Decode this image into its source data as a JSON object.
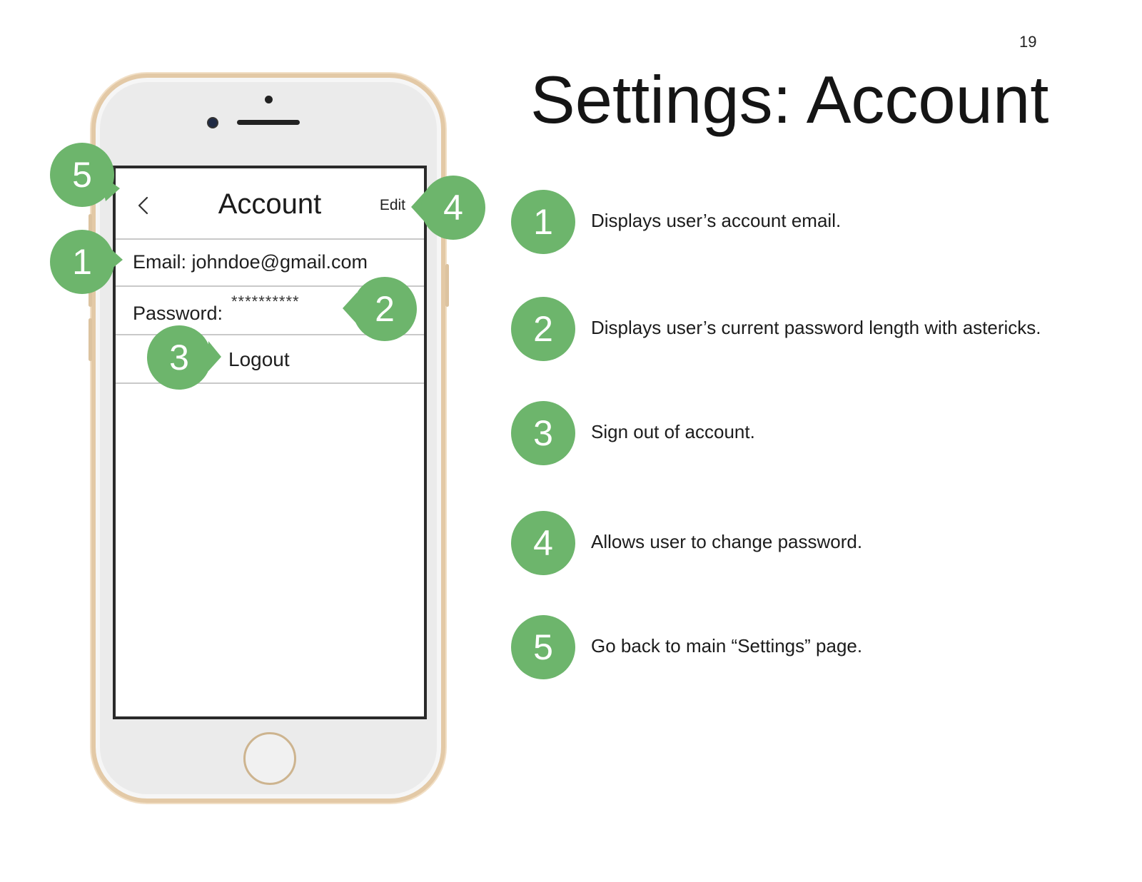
{
  "page_number": "19",
  "page_title": "Settings: Account",
  "phone_screen": {
    "nav": {
      "title": "Account",
      "edit_label": "Edit",
      "back_icon": "chevron-left-icon"
    },
    "email_row": "Email: johndoe@gmail.com",
    "password_row": {
      "label": "Password:",
      "mask": "**********"
    },
    "logout_label": "Logout"
  },
  "callouts": [
    "5",
    "1",
    "4",
    "2",
    "3"
  ],
  "legend": [
    {
      "number": "1",
      "text": "Displays user’s account email."
    },
    {
      "number": "2",
      "text": "Displays user’s current password length with astericks."
    },
    {
      "number": "3",
      "text": "Sign out of account."
    },
    {
      "number": "4",
      "text": "Allows user to change password."
    },
    {
      "number": "5",
      "text": "Go back to main “Settings” page."
    }
  ],
  "colors": {
    "callout_green": "#6db56c",
    "phone_frame_gold": "#e3c9a6"
  }
}
